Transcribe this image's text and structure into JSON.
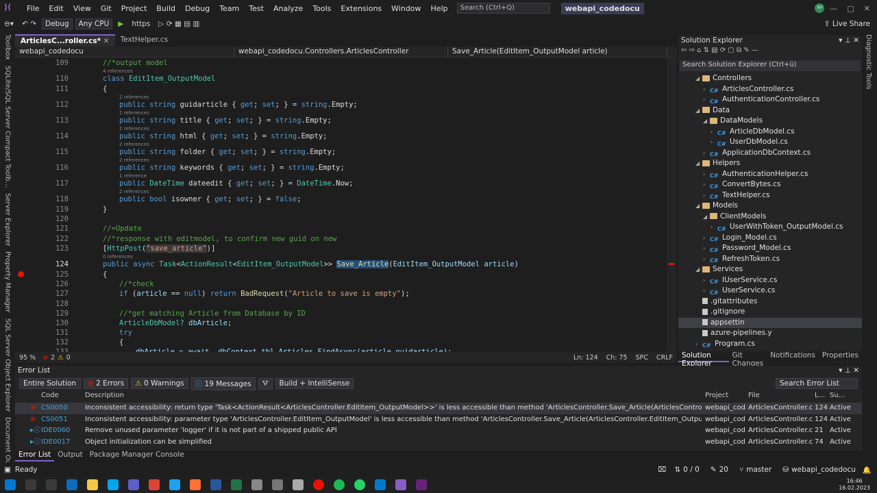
{
  "menu": [
    "File",
    "Edit",
    "View",
    "Git",
    "Project",
    "Build",
    "Debug",
    "Team",
    "Test",
    "Analyze",
    "Tools",
    "Extensions",
    "Window",
    "Help"
  ],
  "search_placeholder": "Search (Ctrl+Q)",
  "solution_name": "webapi_codedocu",
  "user_initials": "RP",
  "live_share": "Live Share",
  "toolbar": {
    "config": "Debug",
    "platform": "Any CPU",
    "run": "https"
  },
  "left_rail": [
    "Toolbox",
    "SQLite/SQL Server Compact Toolb...",
    "Server Explorer",
    "Property Manager",
    "SQL Server Object Explorer",
    "Document Outline"
  ],
  "right_rail": [
    "Diagnostic Tools"
  ],
  "doc_tabs": [
    "ArticlesC...roller.cs*",
    "TextHelper.cs"
  ],
  "nav": {
    "project": "webapi_codedocu",
    "class": "webapi_codedocu.Controllers.ArticlesController",
    "member": "Save_Article(EditItem_OutputModel article)"
  },
  "editor_status": {
    "zoom": "95 %",
    "errors": "2",
    "warnings": "0",
    "ln": "Ln: 124",
    "ch": "Ch: 75",
    "spc": "SPC",
    "crlf": "CRLF"
  },
  "code": {
    "l109": "//*output model",
    "h110": "4 references",
    "l110a": "class",
    "l110b": "EditItem_OutputModel",
    "l111": "{",
    "h112": "2 references",
    "l112": "guidarticle",
    "h113": "2 references",
    "l113": "title",
    "h114": "2 references",
    "l114": "html",
    "h115": "2 references",
    "l115": "folder",
    "h116": "2 references",
    "l116": "keywords",
    "h117": "1 reference",
    "l117": "dateedit",
    "h118": "2 references",
    "l118": "isowner",
    "l119": "}",
    "l121": "//=Update",
    "l122": "//*response with editmodel, to confirm new guid on new",
    "l123a": "HttpPost",
    "l123b": "\"save_article\"",
    "h124": "0 references",
    "l124_method": "Save_Article",
    "l124_param": "EditItem_OutputModel article",
    "l125": "{",
    "l126": "//*check",
    "l127": "\"Article to save is empty\"",
    "l129": "//*get matching Article from Database by ID",
    "l130a": "ArticleDbModel?",
    "l130b": "dbArticle;",
    "l131": "try",
    "l132": "{",
    "l133": "dbArticle = await _dbContext.tbl_Articles.FindAsync(article.guidarticle);"
  },
  "line_numbers": [
    "109",
    "110",
    "111",
    "112",
    "113",
    "114",
    "115",
    "116",
    "117",
    "118",
    "119",
    "120",
    "121",
    "122",
    "123",
    "124",
    "125",
    "126",
    "127",
    "128",
    "129",
    "130",
    "131",
    "132",
    "133"
  ],
  "solution_explorer": {
    "title": "Solution Explorer",
    "search": "Search Solution Explorer (Ctrl+ü)",
    "items": [
      {
        "label": "Controllers",
        "type": "folder",
        "indent": 1
      },
      {
        "label": "ArticlesController.cs",
        "type": "cs",
        "indent": 2
      },
      {
        "label": "AuthenticationController.cs",
        "type": "cs",
        "indent": 2
      },
      {
        "label": "Data",
        "type": "folder",
        "indent": 1
      },
      {
        "label": "DataModels",
        "type": "folder",
        "indent": 2
      },
      {
        "label": "ArticleDbModel.cs",
        "type": "cs",
        "indent": 3
      },
      {
        "label": "UserDbModel.cs",
        "type": "cs",
        "indent": 3
      },
      {
        "label": "ApplicationDbContext.cs",
        "type": "cs",
        "indent": 2
      },
      {
        "label": "Helpers",
        "type": "folder",
        "indent": 1
      },
      {
        "label": "AuthenticationHelper.cs",
        "type": "cs",
        "indent": 2
      },
      {
        "label": "ConvertBytes.cs",
        "type": "cs",
        "indent": 2
      },
      {
        "label": "TextHelper.cs",
        "type": "cs",
        "indent": 2
      },
      {
        "label": "Models",
        "type": "folder",
        "indent": 1
      },
      {
        "label": "ClientModels",
        "type": "folder",
        "indent": 2
      },
      {
        "label": "UserWithToken_OutputModel.cs",
        "type": "cs",
        "indent": 3
      },
      {
        "label": "Login_Model.cs",
        "type": "cs",
        "indent": 2
      },
      {
        "label": "Password_Model.cs",
        "type": "cs",
        "indent": 2
      },
      {
        "label": "RefreshToken.cs",
        "type": "cs",
        "indent": 2
      },
      {
        "label": "Services",
        "type": "folder",
        "indent": 1
      },
      {
        "label": "IUserService.cs",
        "type": "cs",
        "indent": 2
      },
      {
        "label": "UserService.cs",
        "type": "cs",
        "indent": 2
      },
      {
        "label": ".gitattributes",
        "type": "file",
        "indent": 1
      },
      {
        "label": ".gitignore",
        "type": "file",
        "indent": 1
      },
      {
        "label": "appsettin",
        "type": "file",
        "indent": 1,
        "selected": true
      },
      {
        "label": "azure-pipelines.y",
        "type": "file",
        "indent": 1
      },
      {
        "label": "Program.cs",
        "type": "cs",
        "indent": 1
      }
    ],
    "tabs": [
      "Solution Explorer",
      "Git Changes",
      "Notifications",
      "Properties"
    ]
  },
  "error_list": {
    "title": "Error List",
    "scope": "Entire Solution",
    "errors": "2 Errors",
    "warnings": "0 Warnings",
    "messages": "19 Messages",
    "build": "Build + IntelliSense",
    "search": "Search Error List",
    "columns": [
      "Code",
      "Description",
      "Project",
      "File",
      "L...",
      "Su..."
    ],
    "rows": [
      {
        "code": "CS0050",
        "desc": "Inconsistent accessibility: return type 'Task<ActionResult<ArticlesController.EditItem_OutputModel>>' is less accessible than method 'ArticlesController.Save_Article(ArticlesController.EditItem_OutputModel)'",
        "project": "webapi_cod...",
        "file": "ArticlesController.cs",
        "line": "124",
        "state": "Active",
        "kind": "error"
      },
      {
        "code": "CS0051",
        "desc": "Inconsistent accessibility: parameter type 'ArticlesController.EditItem_OutputModel' is less accessible than method 'ArticlesController.Save_Article(ArticlesController.EditItem_OutputModel)'",
        "project": "webapi_cod...",
        "file": "ArticlesController.cs",
        "line": "124",
        "state": "Active",
        "kind": "error"
      },
      {
        "code": "IDE0060",
        "desc": "Remove unused parameter 'logger' if it is not part of a shipped public API",
        "project": "webapi_cod...",
        "file": "ArticlesController.cs",
        "line": "21",
        "state": "Active",
        "kind": "info"
      },
      {
        "code": "IDE0017",
        "desc": "Object initialization can be simplified",
        "project": "webapi_cod...",
        "file": "ArticlesController.cs",
        "line": "74",
        "state": "Active",
        "kind": "info"
      }
    ]
  },
  "bottom_tabs": [
    "Error List",
    "Output",
    "Package Manager Console"
  ],
  "status": {
    "ready": "Ready",
    "updown": "0 / 0",
    "pencil": "20",
    "branch": "master",
    "repo": "webapi_codedocu"
  },
  "clock": {
    "time": "16:46",
    "date": "16.02.2023"
  },
  "colors": {
    "accent": "#7f65c8",
    "error": "#e51400",
    "keyword": "#569cd6",
    "type": "#4ec9b0",
    "comment": "#57a64a",
    "string": "#d69d85"
  }
}
